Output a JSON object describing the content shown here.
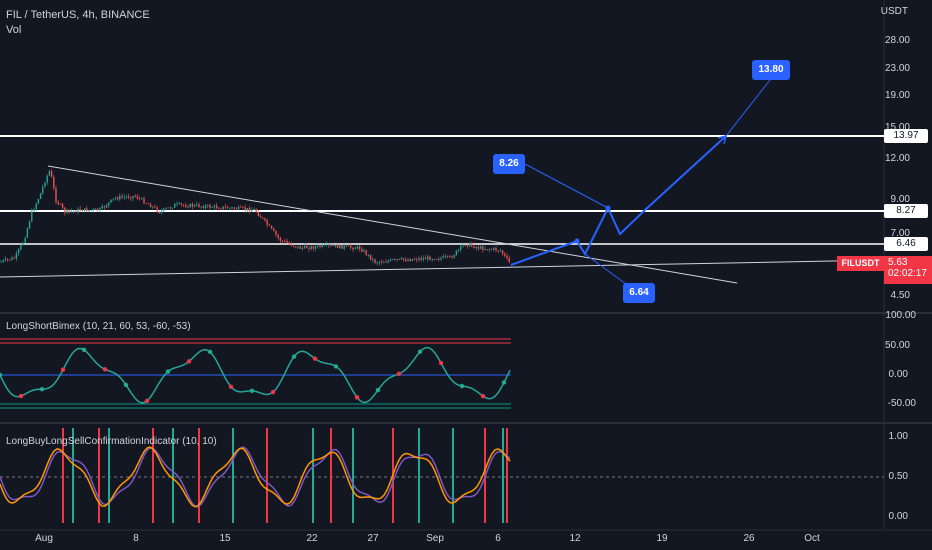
{
  "header": {
    "title": "FIL / TetherUS, 4h, BINANCE",
    "volume_label": "Vol",
    "currency": "USDT"
  },
  "price_axis": [
    "28.00",
    "23.00",
    "19.00",
    "15.00",
    "12.00",
    "9.00",
    "7.00",
    "4.50"
  ],
  "level_tags": [
    "13.97",
    "8.27",
    "6.46"
  ],
  "current_price": {
    "symbol": "FILUSDT",
    "price": "5.63",
    "countdown": "02:02:17",
    "color": "#f23645"
  },
  "callouts": [
    "13.80",
    "8.26",
    "6.64"
  ],
  "indicator1": {
    "title": "LongShortBimex (10, 21, 60, 53, -60, -53)",
    "axis": [
      "100.00",
      "50.00",
      "0.00",
      "-50.00"
    ]
  },
  "indicator2": {
    "title": "LongBuyLongSellConfirmationIndicator (10, 10)",
    "axis": [
      "1.00",
      "0.50",
      "0.00"
    ]
  },
  "time_axis": [
    "Aug",
    "8",
    "15",
    "22",
    "27",
    "Sep",
    "6",
    "12",
    "19",
    "26",
    "Oct"
  ],
  "colors": {
    "background": "#131722",
    "up": "#26a69a",
    "down": "#ef5350",
    "projection": "#2962ff",
    "level_line": "#ffffff"
  }
}
